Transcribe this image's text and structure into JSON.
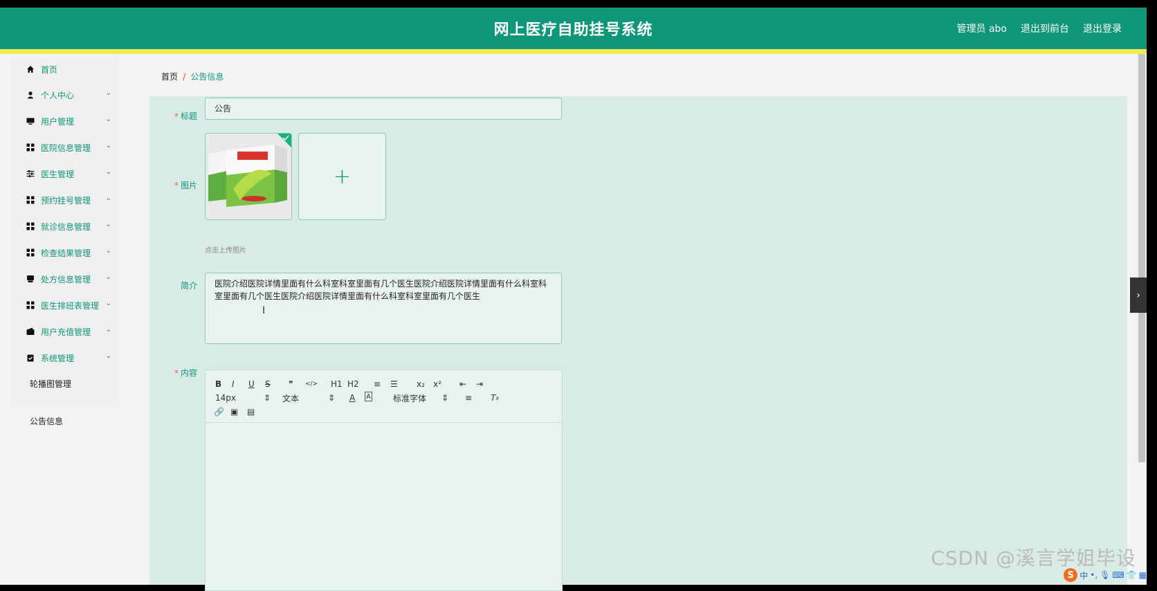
{
  "header": {
    "title": "网上医疗自助挂号系统",
    "user": "管理员 abo",
    "to_front": "退出到前台",
    "logout": "退出登录"
  },
  "sidebar": {
    "items": [
      {
        "label": "首页",
        "icon": "home-icon"
      },
      {
        "label": "个人中心",
        "icon": "user-icon"
      },
      {
        "label": "用户管理",
        "icon": "monitor-icon"
      },
      {
        "label": "医院信息管理",
        "icon": "grid-icon"
      },
      {
        "label": "医生管理",
        "icon": "sliders-icon"
      },
      {
        "label": "预约挂号管理",
        "icon": "grid-icon"
      },
      {
        "label": "就诊信息管理",
        "icon": "grid-icon"
      },
      {
        "label": "检查结果管理",
        "icon": "grid-icon"
      },
      {
        "label": "处方信息管理",
        "icon": "printer-icon"
      },
      {
        "label": "医生排班表管理",
        "icon": "grid-icon"
      },
      {
        "label": "用户充值管理",
        "icon": "wallet-icon"
      },
      {
        "label": "系统管理",
        "icon": "clipboard-icon"
      }
    ],
    "sub_items": [
      "轮播图管理",
      "公告信息"
    ]
  },
  "breadcrumb": {
    "home": "首页",
    "sep": "/",
    "current": "公告信息"
  },
  "form": {
    "title_label": "标题",
    "title_value": "公告",
    "image_label": "图片",
    "upload_hint": "点击上传图片",
    "intro_label": "简介",
    "intro_value": "医院介绍医院详情里面有什么科室科室里面有几个医生医院介绍医院详情里面有什么科室科室里面有几个医生医院介绍医院详情里面有什么科室科室里面有几个医生",
    "content_label": "内容",
    "required_mark": "*"
  },
  "editor": {
    "font_size": "14px",
    "text_format": "文本",
    "font_family": "标准字体",
    "buttons": [
      "B",
      "I",
      "U",
      "S",
      "❞",
      "</>",
      "H1",
      "H2"
    ]
  },
  "watermark": "CSDN @溪言学姐毕设",
  "colors": {
    "primary": "#0e9679",
    "accent": "#f4ea56",
    "required": "#e26b3d"
  }
}
